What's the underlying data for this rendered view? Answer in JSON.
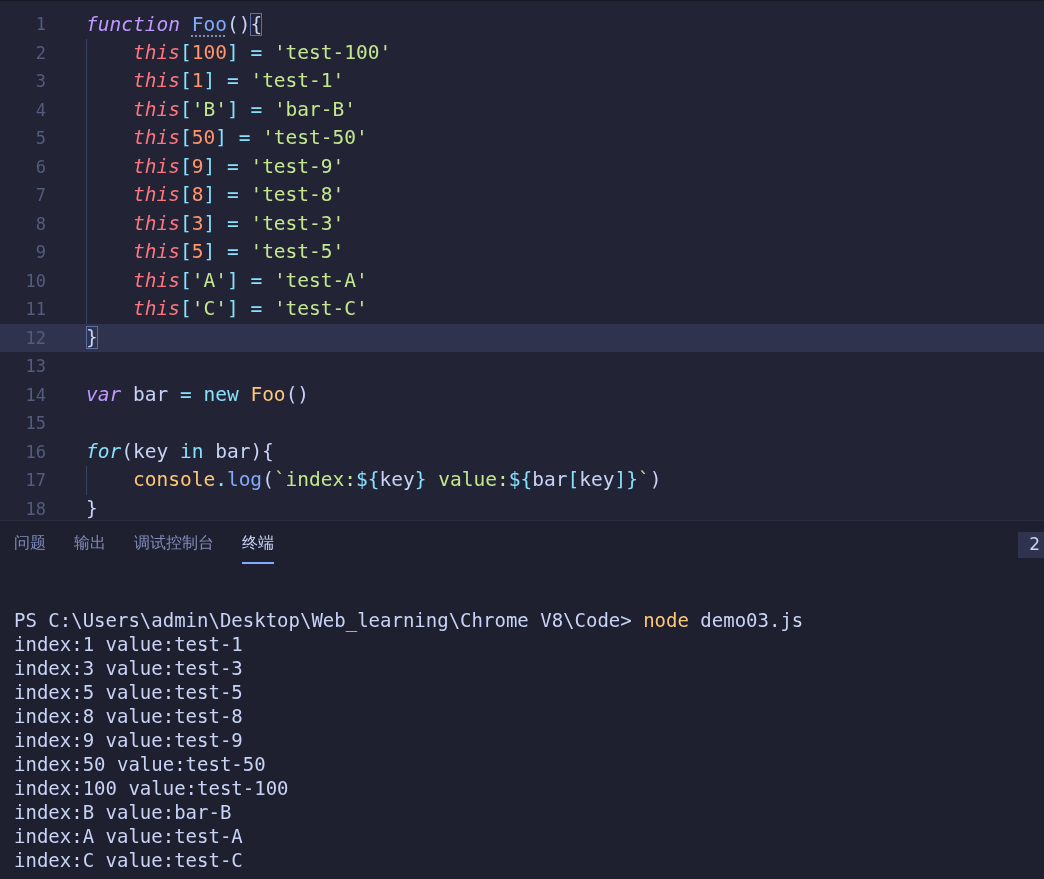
{
  "editor": {
    "lines": [
      {
        "number": "1",
        "selected": false,
        "tokens": [
          {
            "kind": "keyword",
            "text": "function "
          },
          {
            "kind": "hinted-name",
            "text": "Foo"
          },
          {
            "kind": "plain",
            "text": "()"
          },
          {
            "kind": "matched-brace",
            "text": "{"
          }
        ]
      },
      {
        "number": "2",
        "selected": false,
        "indented": true,
        "tokens": [
          {
            "kind": "this",
            "text": "this"
          },
          {
            "kind": "operator",
            "text": "["
          },
          {
            "kind": "number",
            "text": "100"
          },
          {
            "kind": "operator",
            "text": "] = "
          },
          {
            "kind": "string",
            "text": "'test-100'"
          }
        ]
      },
      {
        "number": "3",
        "selected": false,
        "indented": true,
        "tokens": [
          {
            "kind": "this",
            "text": "this"
          },
          {
            "kind": "operator",
            "text": "["
          },
          {
            "kind": "number",
            "text": "1"
          },
          {
            "kind": "operator",
            "text": "] = "
          },
          {
            "kind": "string",
            "text": "'test-1'"
          }
        ]
      },
      {
        "number": "4",
        "selected": false,
        "indented": true,
        "tokens": [
          {
            "kind": "this",
            "text": "this"
          },
          {
            "kind": "operator",
            "text": "["
          },
          {
            "kind": "string",
            "text": "'B'"
          },
          {
            "kind": "operator",
            "text": "] = "
          },
          {
            "kind": "string",
            "text": "'bar-B'"
          }
        ]
      },
      {
        "number": "5",
        "selected": false,
        "indented": true,
        "tokens": [
          {
            "kind": "this",
            "text": "this"
          },
          {
            "kind": "operator",
            "text": "["
          },
          {
            "kind": "number",
            "text": "50"
          },
          {
            "kind": "operator",
            "text": "] = "
          },
          {
            "kind": "string",
            "text": "'test-50'"
          }
        ]
      },
      {
        "number": "6",
        "selected": false,
        "indented": true,
        "tokens": [
          {
            "kind": "this",
            "text": "this"
          },
          {
            "kind": "operator",
            "text": "["
          },
          {
            "kind": "number",
            "text": "9"
          },
          {
            "kind": "operator",
            "text": "] = "
          },
          {
            "kind": "string",
            "text": "'test-9'"
          }
        ]
      },
      {
        "number": "7",
        "selected": false,
        "indented": true,
        "tokens": [
          {
            "kind": "this",
            "text": "this"
          },
          {
            "kind": "operator",
            "text": "["
          },
          {
            "kind": "number",
            "text": "8"
          },
          {
            "kind": "operator",
            "text": "] = "
          },
          {
            "kind": "string",
            "text": "'test-8'"
          }
        ]
      },
      {
        "number": "8",
        "selected": false,
        "indented": true,
        "tokens": [
          {
            "kind": "this",
            "text": "this"
          },
          {
            "kind": "operator",
            "text": "["
          },
          {
            "kind": "number",
            "text": "3"
          },
          {
            "kind": "operator",
            "text": "] = "
          },
          {
            "kind": "string",
            "text": "'test-3'"
          }
        ]
      },
      {
        "number": "9",
        "selected": false,
        "indented": true,
        "tokens": [
          {
            "kind": "this",
            "text": "this"
          },
          {
            "kind": "operator",
            "text": "["
          },
          {
            "kind": "number",
            "text": "5"
          },
          {
            "kind": "operator",
            "text": "] = "
          },
          {
            "kind": "string",
            "text": "'test-5'"
          }
        ]
      },
      {
        "number": "10",
        "selected": false,
        "indented": true,
        "tokens": [
          {
            "kind": "this",
            "text": "this"
          },
          {
            "kind": "operator",
            "text": "["
          },
          {
            "kind": "string",
            "text": "'A'"
          },
          {
            "kind": "operator",
            "text": "] = "
          },
          {
            "kind": "string",
            "text": "'test-A'"
          }
        ]
      },
      {
        "number": "11",
        "selected": false,
        "indented": true,
        "tokens": [
          {
            "kind": "this",
            "text": "this"
          },
          {
            "kind": "operator",
            "text": "["
          },
          {
            "kind": "string",
            "text": "'C'"
          },
          {
            "kind": "operator",
            "text": "] = "
          },
          {
            "kind": "string",
            "text": "'test-C'"
          }
        ]
      },
      {
        "number": "12",
        "selected": true,
        "tokens": [
          {
            "kind": "matched-brace",
            "text": "}"
          }
        ]
      },
      {
        "number": "13",
        "selected": false
      },
      {
        "number": "14",
        "selected": false,
        "tokens": [
          {
            "kind": "keyword",
            "text": "var"
          },
          {
            "kind": "plain",
            "text": " bar "
          },
          {
            "kind": "operator",
            "text": "= new "
          },
          {
            "kind": "call",
            "text": "Foo"
          },
          {
            "kind": "plain",
            "text": "()"
          }
        ]
      },
      {
        "number": "15",
        "selected": false
      },
      {
        "number": "16",
        "selected": false,
        "tokens": [
          {
            "kind": "control",
            "text": "for"
          },
          {
            "kind": "plain",
            "text": "(key "
          },
          {
            "kind": "operator",
            "text": "in"
          },
          {
            "kind": "plain",
            "text": " bar){"
          }
        ]
      },
      {
        "number": "17",
        "selected": false,
        "indented": true,
        "tokens": [
          {
            "kind": "call",
            "text": "console"
          },
          {
            "kind": "operator",
            "text": "."
          },
          {
            "kind": "method",
            "text": "log"
          },
          {
            "kind": "plain",
            "text": "("
          },
          {
            "kind": "string",
            "text": "`index:"
          },
          {
            "kind": "operator",
            "text": "${"
          },
          {
            "kind": "plain",
            "text": "key"
          },
          {
            "kind": "operator",
            "text": "}"
          },
          {
            "kind": "string",
            "text": " value:"
          },
          {
            "kind": "operator",
            "text": "${"
          },
          {
            "kind": "plain",
            "text": "bar"
          },
          {
            "kind": "operator",
            "text": "["
          },
          {
            "kind": "plain",
            "text": "key"
          },
          {
            "kind": "operator",
            "text": "]}"
          },
          {
            "kind": "string",
            "text": "`"
          },
          {
            "kind": "plain",
            "text": ")"
          }
        ]
      },
      {
        "number": "18",
        "selected": false,
        "tokens": [
          {
            "kind": "plain",
            "text": "}"
          }
        ]
      }
    ]
  },
  "panel": {
    "tabs": [
      {
        "label": "问题",
        "selected": false
      },
      {
        "label": "输出",
        "selected": false
      },
      {
        "label": "调试控制台",
        "selected": false
      },
      {
        "label": "终端",
        "selected": true
      }
    ],
    "terminal_count": "2",
    "terminal": [
      {
        "tokens": [
          {
            "kind": "plain",
            "text": "PS C:\\Users\\admin\\Desktop\\Web_learning\\Chrome V8\\Code> "
          },
          {
            "kind": "command",
            "text": "node"
          },
          {
            "kind": "plain",
            "text": " demo03.js"
          }
        ]
      },
      {
        "tokens": [
          {
            "kind": "plain",
            "text": "index:1 value:test-1"
          }
        ]
      },
      {
        "tokens": [
          {
            "kind": "plain",
            "text": "index:3 value:test-3"
          }
        ]
      },
      {
        "tokens": [
          {
            "kind": "plain",
            "text": "index:5 value:test-5"
          }
        ]
      },
      {
        "tokens": [
          {
            "kind": "plain",
            "text": "index:8 value:test-8"
          }
        ]
      },
      {
        "tokens": [
          {
            "kind": "plain",
            "text": "index:9 value:test-9"
          }
        ]
      },
      {
        "tokens": [
          {
            "kind": "plain",
            "text": "index:50 value:test-50"
          }
        ]
      },
      {
        "tokens": [
          {
            "kind": "plain",
            "text": "index:100 value:test-100"
          }
        ]
      },
      {
        "tokens": [
          {
            "kind": "plain",
            "text": "index:B value:bar-B"
          }
        ]
      },
      {
        "tokens": [
          {
            "kind": "plain",
            "text": "index:A value:test-A"
          }
        ]
      },
      {
        "tokens": [
          {
            "kind": "plain",
            "text": "index:C value:test-C"
          }
        ]
      }
    ]
  }
}
